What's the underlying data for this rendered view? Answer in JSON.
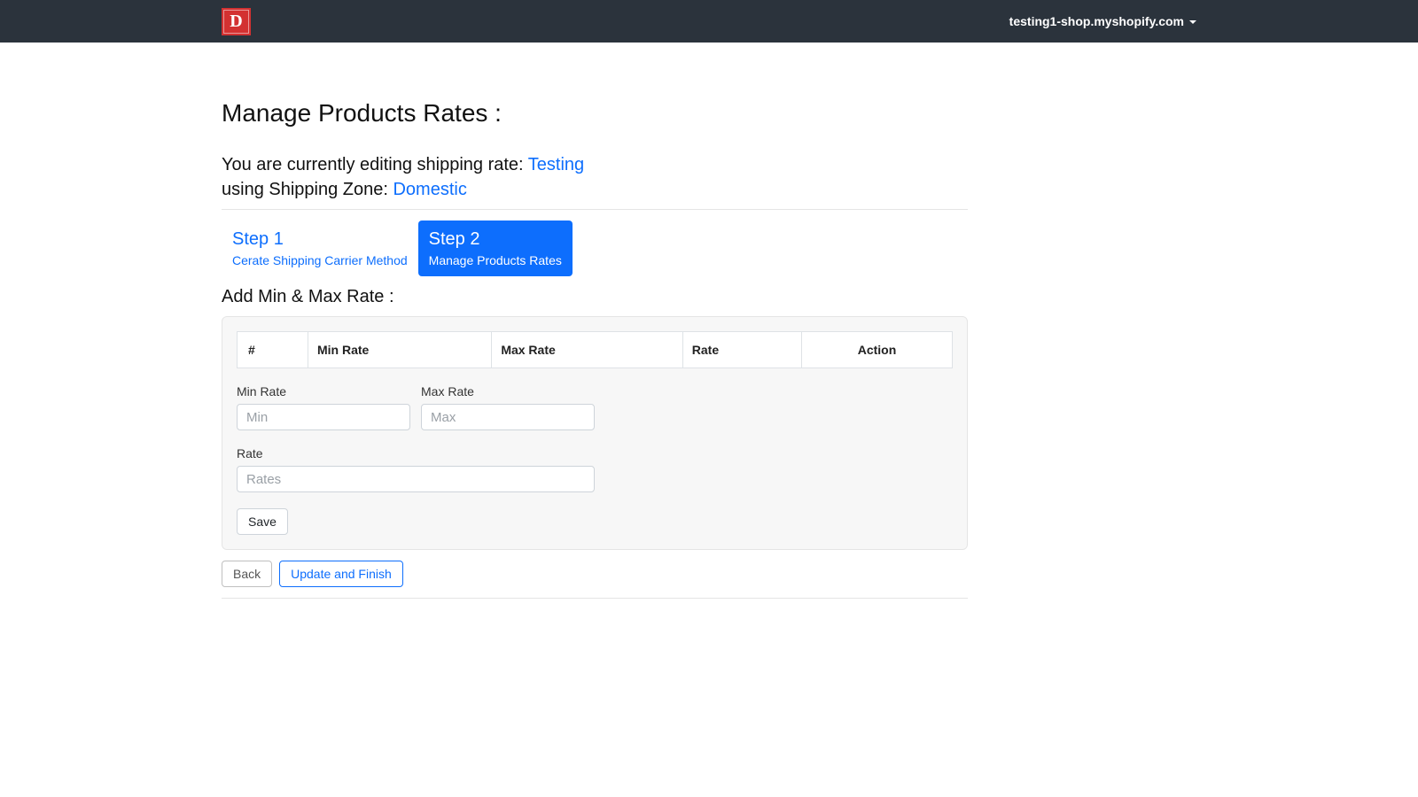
{
  "header": {
    "logo_letter": "D",
    "shop_domain": "testing1-shop.myshopify.com"
  },
  "page": {
    "title": "Manage Products Rates :",
    "editing_prefix": "You are currently editing shipping rate: ",
    "rate_name": "Testing",
    "zone_prefix": "using Shipping Zone: ",
    "zone_name": "Domestic"
  },
  "steps": [
    {
      "title": "Step 1",
      "sub": "Cerate Shipping Carrier Method",
      "active": false
    },
    {
      "title": "Step 2",
      "sub": "Manage Products Rates",
      "active": true
    }
  ],
  "section_title": "Add Min & Max Rate :",
  "table": {
    "columns": [
      "#",
      "Min Rate",
      "Max Rate",
      "Rate",
      "Action"
    ]
  },
  "form": {
    "min_label": "Min Rate",
    "min_placeholder": "Min",
    "max_label": "Max Rate",
    "max_placeholder": "Max",
    "rate_label": "Rate",
    "rate_placeholder": "Rates",
    "save_label": "Save"
  },
  "footer": {
    "back_label": "Back",
    "finish_label": "Update and Finish"
  }
}
